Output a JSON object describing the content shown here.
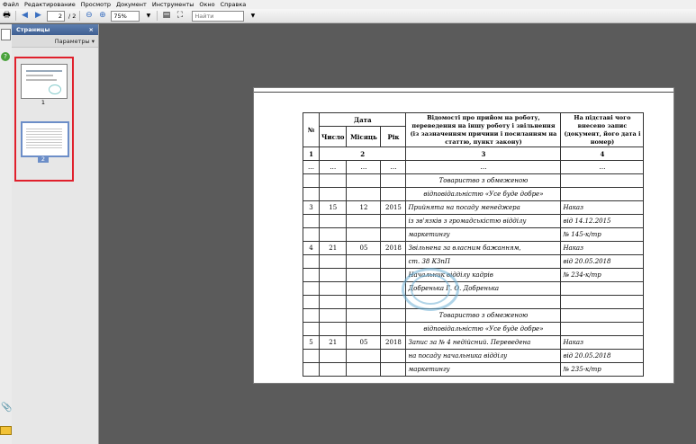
{
  "menu": [
    "Файл",
    "Редактирование",
    "Просмотр",
    "Документ",
    "Инструменты",
    "Окно",
    "Справка"
  ],
  "toolbar": {
    "page_current": "2",
    "page_total": "/ 2",
    "zoom": "75%",
    "search_placeholder": "Найти"
  },
  "panel": {
    "title": "Страницы",
    "close": "×",
    "options": "Параметры ▾",
    "thumbs": [
      {
        "label": "1"
      },
      {
        "label": "2"
      }
    ]
  },
  "table": {
    "headers": {
      "num": "№",
      "date": "Дата",
      "day": "Число",
      "month": "Місяць",
      "year": "Рік",
      "info": "Відомості про прийом на роботу, переведення на іншу роботу і звільнення (із зазначенням причини і посиланням на статтю, пункт закону)",
      "basis": "На підставі чого внесено запис (документ, його дата і номер)"
    },
    "colnums": [
      "1",
      "2",
      "3",
      "4"
    ],
    "ellipsis_row": [
      "…",
      "…",
      "…",
      "…",
      "…",
      "…"
    ],
    "rows": [
      [
        "",
        "",
        "",
        "",
        "Товариство з обмеженою",
        ""
      ],
      [
        "",
        "",
        "",
        "",
        "відповідальністю «Усе буде добре»",
        ""
      ],
      [
        "3",
        "15",
        "12",
        "2015",
        "Прийнята на посаду менеджера",
        "Наказ"
      ],
      [
        "",
        "",
        "",
        "",
        "із зв'язків з громадськістю відділу",
        "від 14.12.2015"
      ],
      [
        "",
        "",
        "",
        "",
        "маркетингу",
        "№ 145-к/тр"
      ],
      [
        "4",
        "21",
        "05",
        "2018",
        "Звільнена за власним бажанням,",
        "Наказ"
      ],
      [
        "",
        "",
        "",
        "",
        "ст. 38 КЗпП",
        "від 20.05.2018"
      ],
      [
        "",
        "",
        "",
        "",
        "Начальник відділу кадрів",
        "№ 234-к/тр"
      ],
      [
        "",
        "",
        "",
        "",
        "Добренька        Г. О. Добренька",
        ""
      ],
      [
        "",
        "",
        "",
        "",
        "",
        ""
      ],
      [
        "",
        "",
        "",
        "",
        "Товариство з обмеженою",
        ""
      ],
      [
        "",
        "",
        "",
        "",
        "відповідальністю «Усе буде добре»",
        ""
      ],
      [
        "5",
        "21",
        "05",
        "2018",
        "Запис за № 4 недійсний. Переведена",
        "Наказ"
      ],
      [
        "",
        "",
        "",
        "",
        "на посаду начальника відділу",
        "від 20.05.2018"
      ],
      [
        "",
        "",
        "",
        "",
        "маркетингу",
        "№ 235-к/тр"
      ]
    ]
  }
}
